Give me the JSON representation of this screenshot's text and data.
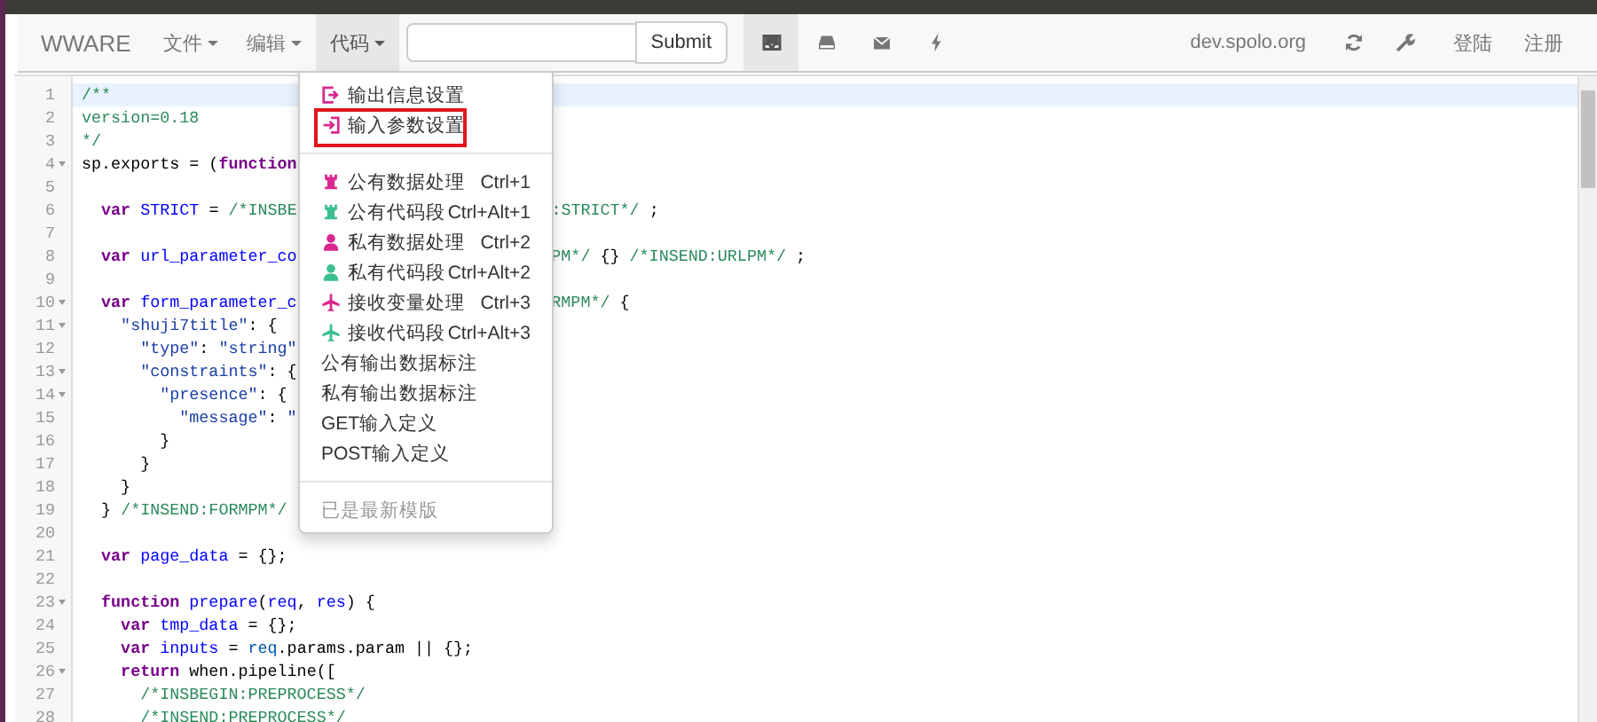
{
  "navbar": {
    "brand": "WWARE",
    "menus": [
      {
        "label": "文件",
        "open": false
      },
      {
        "label": "编辑",
        "open": false
      },
      {
        "label": "代码",
        "open": true
      }
    ],
    "submit": "Submit",
    "icon_buttons": [
      {
        "kind": "inbox",
        "selected": true
      },
      {
        "kind": "drive",
        "selected": false
      },
      {
        "kind": "mail",
        "selected": false
      },
      {
        "kind": "bolt",
        "selected": false
      }
    ],
    "host": "dev.spolo.org",
    "tools": [
      {
        "kind": "refresh"
      },
      {
        "kind": "wrench"
      }
    ],
    "links": [
      "登陆",
      "注册"
    ]
  },
  "menu": {
    "groups": [
      [
        {
          "kind": "output",
          "label": "输出信息设置",
          "color": "#d9288f",
          "annotated": false
        },
        {
          "kind": "input",
          "label": "输入参数设置",
          "color": "#d9288f",
          "annotated": true
        }
      ],
      [
        {
          "kind": "public",
          "label": "公有数据处理",
          "shortcut": "Ctrl+1",
          "color": "#d9288f"
        },
        {
          "kind": "public",
          "label": "公有代码段",
          "shortcut": "Ctrl+Alt+1",
          "color": "#3cbf8f"
        },
        {
          "kind": "private",
          "label": "私有数据处理",
          "shortcut": "Ctrl+2",
          "color": "#d9288f"
        },
        {
          "kind": "private",
          "label": "私有代码段",
          "shortcut": "Ctrl+Alt+2",
          "color": "#3cbf8f"
        },
        {
          "kind": "receive",
          "label": "接收变量处理",
          "shortcut": "Ctrl+3",
          "color": "#d9288f"
        },
        {
          "kind": "receive",
          "label": "接收代码段",
          "shortcut": "Ctrl+Alt+3",
          "color": "#3cbf8f"
        },
        {
          "kind": "plain",
          "label": "公有输出数据标注"
        },
        {
          "kind": "plain",
          "label": "私有输出数据标注"
        },
        {
          "kind": "plain",
          "label": "GET输入定义"
        },
        {
          "kind": "plain",
          "label": "POST输入定义"
        }
      ],
      [
        {
          "kind": "plain",
          "label": "已是最新模版",
          "disabled": true
        }
      ]
    ]
  },
  "editor": {
    "lines": [
      {
        "number": "1",
        "active": true,
        "code": [
          {
            "kind": "comment",
            "text": "/**"
          }
        ]
      },
      {
        "number": "2",
        "code": [
          {
            "kind": "comment",
            "text": "version=0.18"
          }
        ]
      },
      {
        "number": "3",
        "code": [
          {
            "kind": "comment",
            "text": "*/"
          }
        ]
      },
      {
        "number": "4",
        "fold": true,
        "code": [
          {
            "kind": "plain",
            "text": "sp.exports = ("
          },
          {
            "kind": "keyword",
            "text": "function"
          }
        ]
      },
      {
        "number": "5"
      },
      {
        "number": "6",
        "code": [
          {
            "kind": "keyword",
            "text": "  var "
          },
          {
            "kind": "def",
            "text": "STRICT"
          },
          {
            "kind": "plain",
            "text": " = "
          },
          {
            "kind": "comment",
            "text": "/*INSBE"
          }
        ],
        "tail": [
          {
            "kind": "comment",
            "text": ":STRICT*/"
          },
          {
            "kind": "plain",
            "text": " ;"
          }
        ]
      },
      {
        "number": "7"
      },
      {
        "number": "8",
        "code": [
          {
            "kind": "keyword",
            "text": "  var "
          },
          {
            "kind": "def",
            "text": "url_parameter_co"
          }
        ],
        "tail": [
          {
            "kind": "comment",
            "text": "PM*/"
          },
          {
            "kind": "plain",
            "text": " {} "
          },
          {
            "kind": "comment",
            "text": "/*INSEND:URLPM*/"
          },
          {
            "kind": "plain",
            "text": " ;"
          }
        ]
      },
      {
        "number": "9"
      },
      {
        "number": "10",
        "fold": true,
        "code": [
          {
            "kind": "keyword",
            "text": "  var "
          },
          {
            "kind": "def",
            "text": "form_parameter_c"
          }
        ],
        "tail": [
          {
            "kind": "comment",
            "text": "RMPM*/"
          },
          {
            "kind": "plain",
            "text": " {"
          }
        ]
      },
      {
        "number": "11",
        "fold": true,
        "code": [
          {
            "kind": "string",
            "text": "    \"shuji7title\""
          },
          {
            "kind": "plain",
            "text": ": {"
          }
        ]
      },
      {
        "number": "12",
        "code": [
          {
            "kind": "string",
            "text": "      \"type\""
          },
          {
            "kind": "plain",
            "text": ": "
          },
          {
            "kind": "string",
            "text": "\"string\""
          }
        ]
      },
      {
        "number": "13",
        "fold": true,
        "code": [
          {
            "kind": "string",
            "text": "      \"constraints\""
          },
          {
            "kind": "plain",
            "text": ": {"
          }
        ]
      },
      {
        "number": "14",
        "fold": true,
        "code": [
          {
            "kind": "string",
            "text": "        \"presence\""
          },
          {
            "kind": "plain",
            "text": ": {"
          }
        ]
      },
      {
        "number": "15",
        "code": [
          {
            "kind": "string",
            "text": "          \"message\""
          },
          {
            "kind": "plain",
            "text": ": "
          },
          {
            "kind": "string",
            "text": "\""
          }
        ]
      },
      {
        "number": "16",
        "code": [
          {
            "kind": "plain",
            "text": "        }"
          }
        ]
      },
      {
        "number": "17",
        "code": [
          {
            "kind": "plain",
            "text": "      }"
          }
        ]
      },
      {
        "number": "18",
        "code": [
          {
            "kind": "plain",
            "text": "    }"
          }
        ]
      },
      {
        "number": "19",
        "code": [
          {
            "kind": "plain",
            "text": "  } "
          },
          {
            "kind": "comment",
            "text": "/*INSEND:FORMPM*/"
          }
        ]
      },
      {
        "number": "20"
      },
      {
        "number": "21",
        "code": [
          {
            "kind": "keyword",
            "text": "  var "
          },
          {
            "kind": "def",
            "text": "page_data"
          },
          {
            "kind": "plain",
            "text": " = {};"
          }
        ]
      },
      {
        "number": "22"
      },
      {
        "number": "23",
        "fold": true,
        "code": [
          {
            "kind": "keyword",
            "text": "  function "
          },
          {
            "kind": "def",
            "text": "prepare"
          },
          {
            "kind": "plain",
            "text": "("
          },
          {
            "kind": "def",
            "text": "req"
          },
          {
            "kind": "plain",
            "text": ", "
          },
          {
            "kind": "def",
            "text": "res"
          },
          {
            "kind": "plain",
            "text": ") {"
          }
        ]
      },
      {
        "number": "24",
        "code": [
          {
            "kind": "keyword",
            "text": "    var "
          },
          {
            "kind": "def",
            "text": "tmp_data"
          },
          {
            "kind": "plain",
            "text": " = {};"
          }
        ]
      },
      {
        "number": "25",
        "code": [
          {
            "kind": "keyword",
            "text": "    var "
          },
          {
            "kind": "def",
            "text": "inputs"
          },
          {
            "kind": "plain",
            "text": " = "
          },
          {
            "kind": "var2",
            "text": "req"
          },
          {
            "kind": "plain",
            "text": ".params.param || {};"
          }
        ]
      },
      {
        "number": "26",
        "fold": true,
        "code": [
          {
            "kind": "keyword",
            "text": "    return "
          },
          {
            "kind": "plain",
            "text": "when.pipeline(["
          }
        ]
      },
      {
        "number": "27",
        "code": [
          {
            "kind": "comment",
            "text": "      /*INSBEGIN:PREPROCESS*/"
          }
        ]
      },
      {
        "number": "28",
        "code": [
          {
            "kind": "comment",
            "text": "      /*INSEND:PREPROCESS*/"
          }
        ]
      }
    ]
  }
}
